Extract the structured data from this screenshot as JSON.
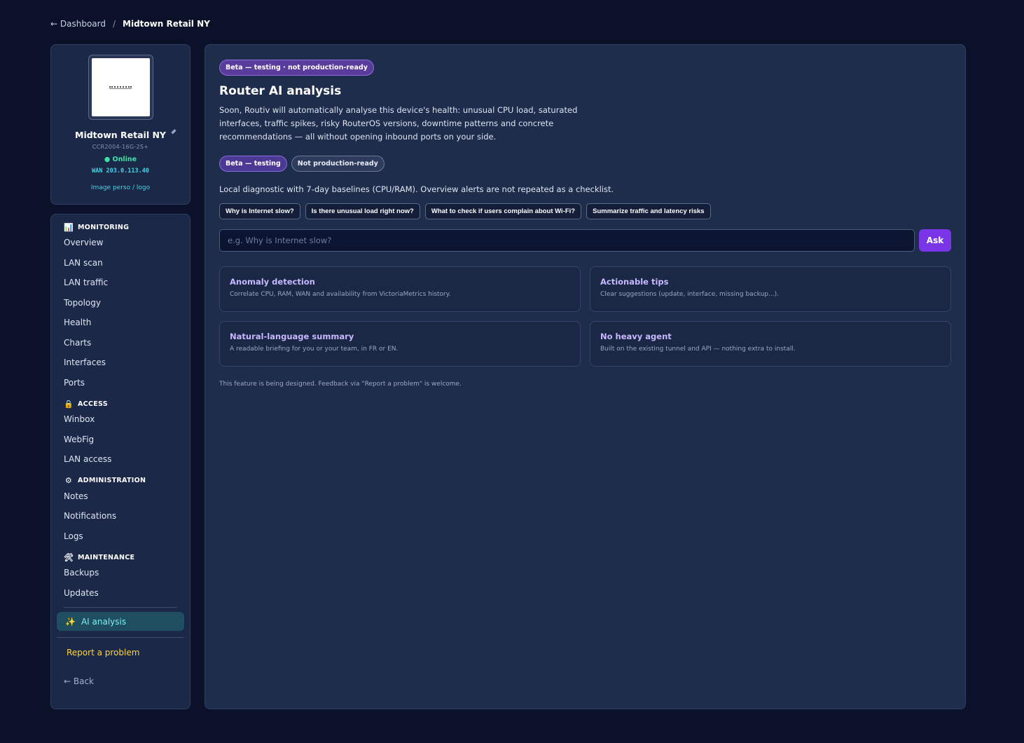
{
  "breadcrumb": {
    "back_label": "← Dashboard",
    "separator": "/",
    "current": "Midtown Retail NY"
  },
  "device": {
    "name": "Midtown Retail NY",
    "model": "CCR2004-16G-2S+",
    "status": "● Online",
    "wan": "WAN 203.0.113.40",
    "image_link": "Image perso / logo",
    "status_color": "#3ee0a8"
  },
  "sidebar": {
    "sections": {
      "monitoring": {
        "label": "MONITORING",
        "icon": "bar-chart-icon",
        "items": [
          "Overview",
          "LAN scan",
          "LAN traffic",
          "Topology",
          "Health",
          "Charts",
          "Interfaces",
          "Ports"
        ]
      },
      "access": {
        "label": "ACCESS",
        "icon": "lock-icon",
        "items": [
          "Winbox",
          "WebFig",
          "LAN access"
        ]
      },
      "administration": {
        "label": "ADMINISTRATION",
        "icon": "gear-icon",
        "items": [
          "Notes",
          "Notifications",
          "Logs"
        ]
      },
      "maintenance": {
        "label": "MAINTENANCE",
        "icon": "tools-icon",
        "items": [
          "Backups",
          "Updates"
        ]
      }
    },
    "active_item": "AI analysis",
    "active_icon": "sparkles-icon",
    "report_label": "Report a problem",
    "back_label": "← Back"
  },
  "main": {
    "beta_badge": "Beta — testing · not production-ready",
    "title": "Router AI analysis",
    "description": "Soon, Routiv will automatically analyse this device's health: unusual CPU load, saturated interfaces, traffic spikes, risky RouterOS versions, downtime patterns and concrete recommendations — all without opening inbound ports on your side.",
    "pill_beta": "Beta — testing",
    "pill_not_ready": "Not production-ready",
    "diagnostic_text": "Local diagnostic with 7-day baselines (CPU/RAM). Overview alerts are not repeated as a checklist.",
    "suggestions": [
      "Why is Internet slow?",
      "Is there unusual load right now?",
      "What to check if users complain about Wi-Fi?",
      "Summarize traffic and latency risks"
    ],
    "ask_placeholder": "e.g. Why is Internet slow?",
    "ask_button": "Ask",
    "cards": [
      {
        "title": "Anomaly detection",
        "desc": "Correlate CPU, RAM, WAN and availability from VictoriaMetrics history."
      },
      {
        "title": "Actionable tips",
        "desc": "Clear suggestions (update, interface, missing backup...)."
      },
      {
        "title": "Natural-language summary",
        "desc": "A readable briefing for you or your team, in FR or EN."
      },
      {
        "title": "No heavy agent",
        "desc": "Built on the existing tunnel and API — nothing extra to install."
      }
    ],
    "footnote": "This feature is being designed. Feedback via \"Report a problem\" is welcome."
  },
  "colors": {
    "background": "#0a1128",
    "panel": "#1f2d4d",
    "accent_purple": "#7a35e8",
    "active_teal": "#7ff0f0",
    "report_yellow": "#ffd33a"
  }
}
